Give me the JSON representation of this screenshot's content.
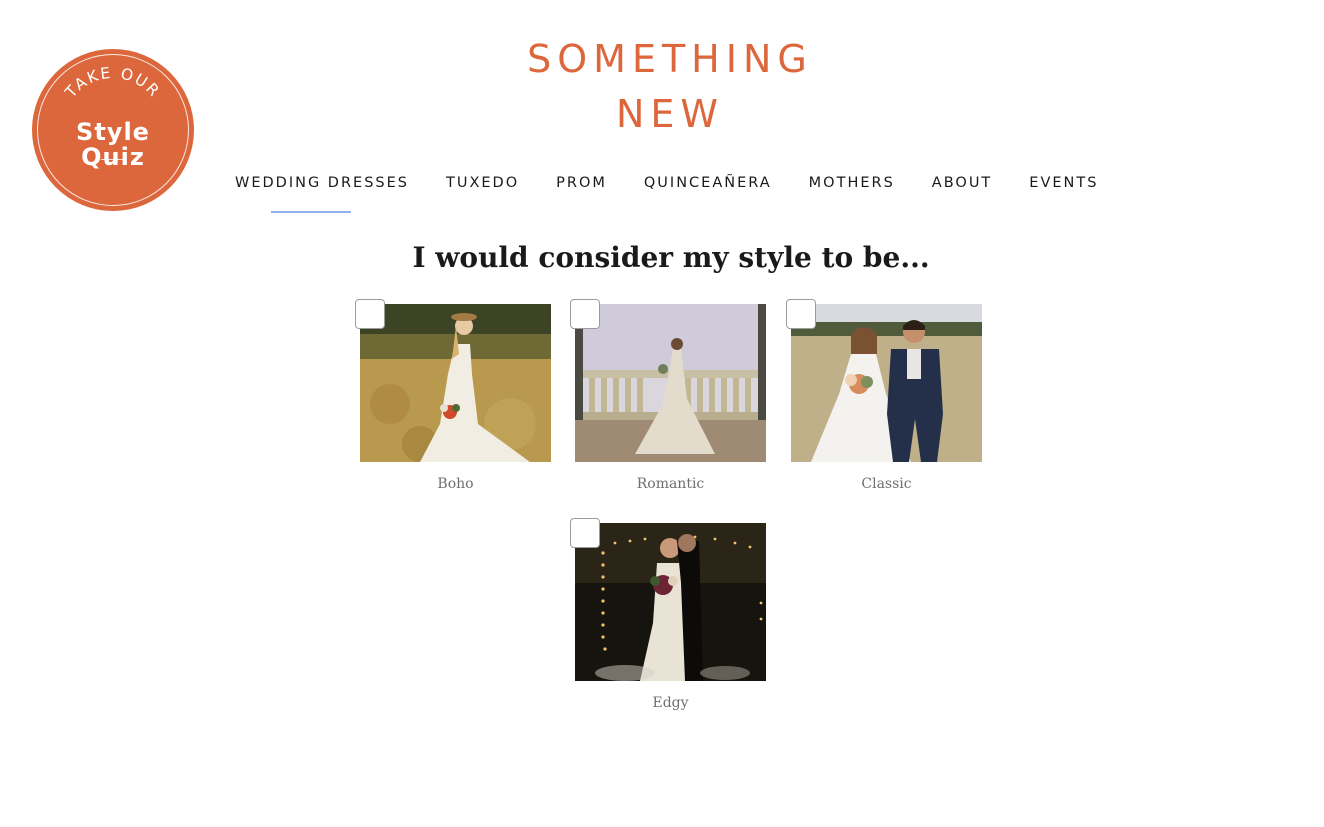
{
  "badge": {
    "line1": "TAKE OUR",
    "line2": "Style",
    "line3": "Quiz"
  },
  "logo": {
    "line1": "SOMETHING",
    "line2": "NEW"
  },
  "nav": {
    "items": [
      {
        "label": "WEDDING DRESSES",
        "active": true
      },
      {
        "label": "TUXEDO"
      },
      {
        "label": "PROM"
      },
      {
        "label": "QUINCEAÑERA"
      },
      {
        "label": "MOTHERS"
      },
      {
        "label": "ABOUT"
      },
      {
        "label": "EVENTS"
      }
    ]
  },
  "quiz": {
    "question": "I would consider my style to be...",
    "options": [
      {
        "label": "Boho",
        "checked": false
      },
      {
        "label": "Romantic",
        "checked": false
      },
      {
        "label": "Classic",
        "checked": false
      },
      {
        "label": "Edgy",
        "checked": false
      }
    ]
  },
  "colors": {
    "brand": "#dd673c",
    "nav_active_underline": "#8fb0ef",
    "text_dark": "#1a1a1a",
    "caption_gray": "#6f6f6f"
  }
}
